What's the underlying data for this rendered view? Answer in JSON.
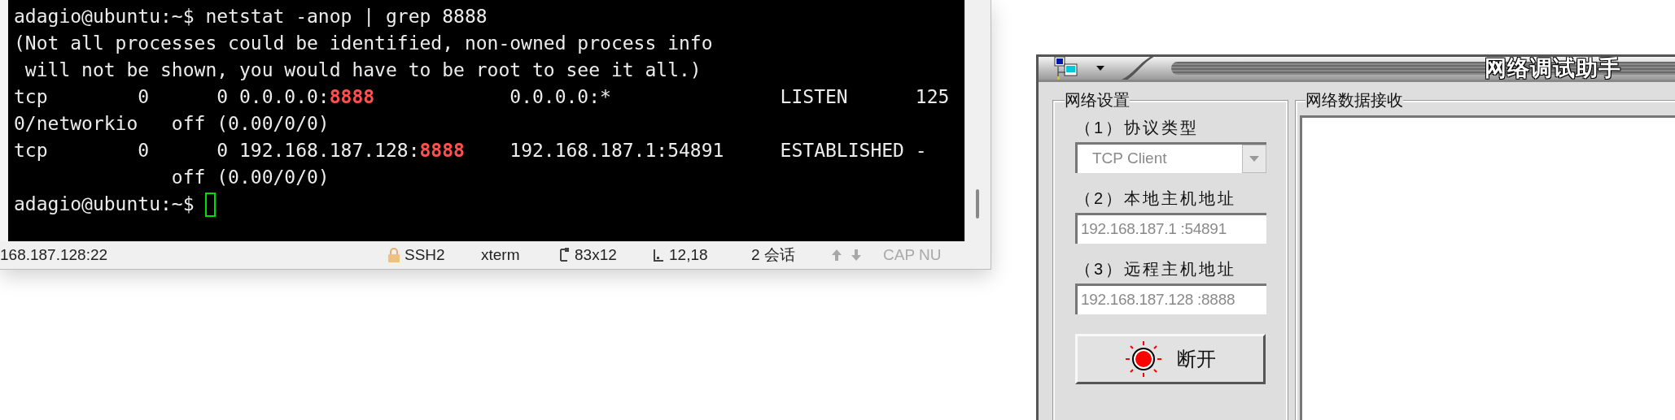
{
  "terminal": {
    "lines": [
      [
        {
          "text": "adagio@ubuntu:~$ netstat -anop | grep 8888",
          "highlighted": false
        }
      ],
      [
        {
          "text": "(Not all processes could be identified, non-owned process info",
          "highlighted": false
        }
      ],
      [
        {
          "text": " will not be shown, you would have to be root to see it all.)",
          "highlighted": false
        }
      ],
      [
        {
          "text": "tcp        0      0 0.0.0.0:",
          "highlighted": false
        },
        {
          "text": "8888",
          "highlighted": true
        },
        {
          "text": "            0.0.0.0:*               LISTEN      125",
          "highlighted": false
        }
      ],
      [
        {
          "text": "0/networkio   off (0.00/0/0)",
          "highlighted": false
        }
      ],
      [
        {
          "text": "tcp        0      0 192.168.187.128:",
          "highlighted": false
        },
        {
          "text": "8888",
          "highlighted": true
        },
        {
          "text": "    192.168.187.1:54891     ESTABLISHED -",
          "highlighted": false
        }
      ],
      [
        {
          "text": "              off (0.00/0/0)",
          "highlighted": false
        }
      ],
      [
        {
          "text": "adagio@ubuntu:~$ ",
          "highlighted": false
        }
      ]
    ],
    "cursor": true
  },
  "status_bar": [
    {
      "kind": "text",
      "text": "168.187.128:22",
      "disabled": false
    },
    {
      "kind": "lock",
      "text": "SSH2",
      "disabled": false
    },
    {
      "kind": "text",
      "text": "xterm",
      "disabled": false
    },
    {
      "kind": "size",
      "text": "83x12",
      "disabled": false
    },
    {
      "kind": "position",
      "text": "12,18",
      "disabled": false
    },
    {
      "kind": "text",
      "text": "2 会话",
      "disabled": false
    },
    {
      "kind": "arrows",
      "disabled": true
    },
    {
      "kind": "text",
      "text": "CAP NU",
      "disabled": true
    }
  ],
  "net_tool": {
    "title": "网络调试助手",
    "settings": {
      "title": "网络设置",
      "fields": [
        {
          "label": "（1）协议类型",
          "kind": "dropdown",
          "value": "TCP Client",
          "disabled": true
        },
        {
          "label": "（2）本地主机地址",
          "kind": "input",
          "value": "192.168.187.1 :54891",
          "disabled": true
        },
        {
          "label": "（3）远程主机地址",
          "kind": "input",
          "value": "192.168.187.128 :8888",
          "disabled": true
        }
      ],
      "button": {
        "label": "断开",
        "connected": true
      }
    },
    "receive": {
      "title": "网络数据接收"
    }
  }
}
